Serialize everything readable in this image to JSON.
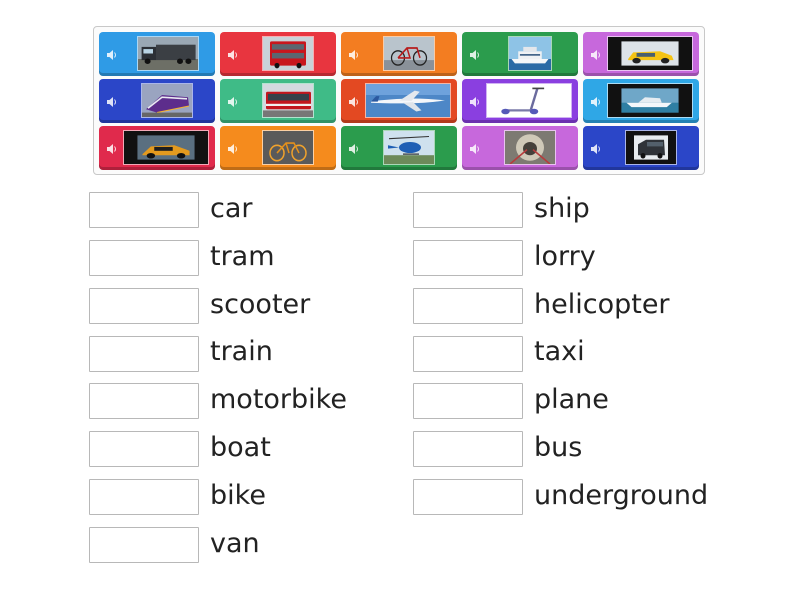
{
  "tiles": [
    {
      "color": "#2f9be6",
      "picture": "lorry"
    },
    {
      "color": "#e8353f",
      "picture": "bus"
    },
    {
      "color": "#f37d21",
      "picture": "bike"
    },
    {
      "color": "#2b9c4d",
      "picture": "ship"
    },
    {
      "color": "#c768dc",
      "picture": "taxi"
    },
    {
      "color": "#2b46c8",
      "picture": "train"
    },
    {
      "color": "#3fbb87",
      "picture": "tram"
    },
    {
      "color": "#e34922",
      "picture": "plane"
    },
    {
      "color": "#8a3fe0",
      "picture": "scooter"
    },
    {
      "color": "#2fa7e6",
      "picture": "boat"
    },
    {
      "color": "#e02a4c",
      "picture": "car"
    },
    {
      "color": "#f58b1d",
      "picture": "motorbike"
    },
    {
      "color": "#2b9c4d",
      "picture": "helicopter"
    },
    {
      "color": "#c768dc",
      "picture": "underground"
    },
    {
      "color": "#2b46c8",
      "picture": "van"
    }
  ],
  "words_left": [
    "car",
    "tram",
    "scooter",
    "train",
    "motorbike",
    "boat",
    "bike",
    "van"
  ],
  "words_right": [
    "ship",
    "lorry",
    "helicopter",
    "taxi",
    "plane",
    "bus",
    "underground"
  ]
}
